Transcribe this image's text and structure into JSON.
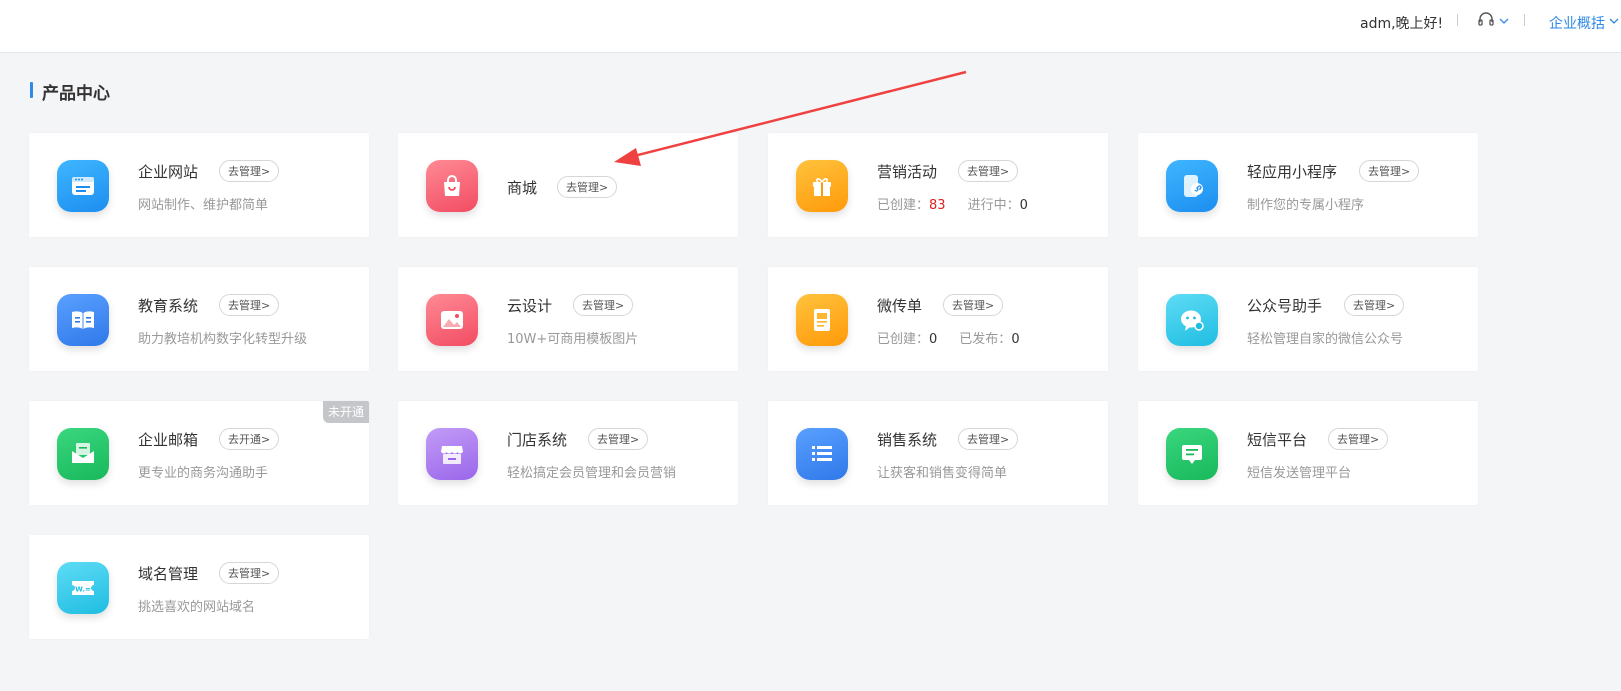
{
  "header": {
    "greeting": "adm,晚上好!",
    "overview_label": "企业概括",
    "support_icon": "headset-icon"
  },
  "section": {
    "title": "产品中心"
  },
  "products": [
    {
      "title": "企业网站",
      "button": "去管理>",
      "desc": "网站制作、维护都简单",
      "icon": "browser-window-icon",
      "color": "#1c9cf6"
    },
    {
      "title": "商城",
      "button": "去管理>",
      "icon": "shopping-bag-icon",
      "color": "#f45b6e"
    },
    {
      "title": "营销活动",
      "button": "去管理>",
      "icon": "gift-icon",
      "color": "#ffa511",
      "stats": [
        {
          "label": "已创建：",
          "value": "83"
        },
        {
          "label": "进行中：",
          "value": "0"
        }
      ]
    },
    {
      "title": "轻应用小程序",
      "button": "去管理>",
      "desc": "制作您的专属小程序",
      "icon": "mini-program-icon",
      "color": "#1c9cf6"
    },
    {
      "title": "教育系统",
      "button": "去管理>",
      "desc": "助力教培机构数字化转型升级",
      "icon": "book-icon",
      "color": "#3e8af2"
    },
    {
      "title": "云设计",
      "button": "去管理>",
      "desc": "10W+可商用模板图片",
      "icon": "image-icon",
      "color": "#f45b6e"
    },
    {
      "title": "微传单",
      "button": "去管理>",
      "icon": "flyer-icon",
      "color": "#ffa511",
      "stats": [
        {
          "label": "已创建：",
          "value": "0"
        },
        {
          "label": "已发布：",
          "value": "0"
        }
      ]
    },
    {
      "title": "公众号助手",
      "button": "去管理>",
      "desc": "轻松管理自家的微信公众号",
      "icon": "wechat-icon",
      "color": "#2fc6e8"
    },
    {
      "title": "企业邮箱",
      "button": "去开通>",
      "desc": "更专业的商务沟通助手",
      "icon": "mail-icon",
      "color": "#25c46a",
      "badge": "未开通"
    },
    {
      "title": "门店系统",
      "button": "去管理>",
      "desc": "轻松搞定会员管理和会员营销",
      "icon": "store-icon",
      "color": "#ad7df0"
    },
    {
      "title": "销售系统",
      "button": "去管理>",
      "desc": "让获客和销售变得简单",
      "icon": "list-icon",
      "color": "#3e8af2"
    },
    {
      "title": "短信平台",
      "button": "去管理>",
      "desc": "短信发送管理平台",
      "icon": "sms-icon",
      "color": "#25c46a"
    },
    {
      "title": "域名管理",
      "button": "去管理>",
      "desc": "挑选喜欢的网站域名",
      "icon": "domain-icon",
      "color": "#2fc6e8"
    }
  ]
}
